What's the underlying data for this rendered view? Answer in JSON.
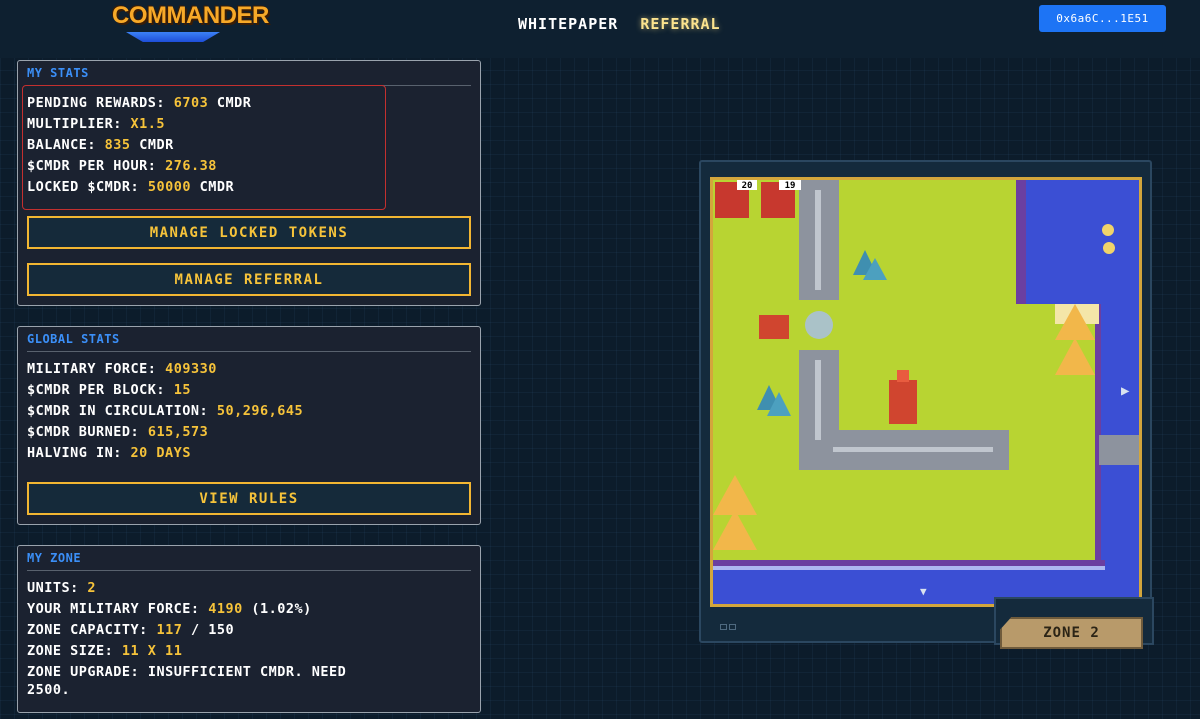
{
  "header": {
    "logo_text": "COMMANDER",
    "nav": [
      {
        "label": "WHITEPAPER",
        "active": false
      },
      {
        "label": "REFERRAL",
        "active": true
      }
    ],
    "wallet_label": "0x6a6C...1E51"
  },
  "my_stats": {
    "title": "MY STATS",
    "pending_rewards": {
      "label": "PENDING REWARDS:",
      "value": "6703",
      "unit": "CMDR"
    },
    "multiplier": {
      "label": "MULTIPLIER:",
      "value": "X1.5"
    },
    "balance": {
      "label": "BALANCE:",
      "value": "835",
      "unit": "CMDR"
    },
    "cmdr_per_hour": {
      "label": "$CMDR PER HOUR:",
      "value": "276.38"
    },
    "locked_cmdr": {
      "label": "LOCKED $CMDR:",
      "value": "50000",
      "unit": "CMDR"
    },
    "manage_locked_button": "MANAGE LOCKED TOKENS",
    "manage_referral_button": "MANAGE REFERRAL"
  },
  "global_stats": {
    "title": "GLOBAL STATS",
    "military_force": {
      "label": "MILITARY FORCE:",
      "value": "409330"
    },
    "cmdr_per_block": {
      "label": "$CMDR PER BLOCK:",
      "value": "15"
    },
    "cmdr_in_circulation": {
      "label": "$CMDR IN CIRCULATION:",
      "value": "50,296,645"
    },
    "cmdr_burned": {
      "label": "$CMDR BURNED:",
      "value": "615,573"
    },
    "halving_in": {
      "label": "HALVING IN:",
      "value": "20 DAYS"
    },
    "view_rules_button": "VIEW RULES"
  },
  "my_zone": {
    "title": "MY ZONE",
    "units": {
      "label": "UNITS:",
      "value": "2"
    },
    "your_military_force": {
      "label": "YOUR MILITARY FORCE:",
      "value": "4190",
      "extra": "(1.02%)"
    },
    "zone_capacity": {
      "label": "ZONE CAPACITY:",
      "value": "117",
      "sep": "/",
      "max": "150"
    },
    "zone_size": {
      "label": "ZONE SIZE:",
      "value": "11 X 11"
    },
    "zone_upgrade": {
      "label": "ZONE UPGRADE:",
      "value": "INSUFFICIENT CMDR. NEED",
      "value_line2": "2500."
    }
  },
  "map": {
    "zone_label": "ZONE 2",
    "unit_counts": [
      "20",
      "19"
    ],
    "arrow_right": "▶",
    "arrow_down": "▼"
  },
  "colors": {
    "accent_blue": "#1d74f5",
    "title_blue": "#3b8ff7",
    "value_yellow": "#f6c33a",
    "button_border": "#f2b632",
    "highlight_red": "#c3302f",
    "grass": "#b8d432",
    "water": "#3b4fd4"
  },
  "icons": [
    "soldier-unit-icon",
    "soldier-unit-icon",
    "tank-icon",
    "tower-icon",
    "tree-icon",
    "mountain-icon"
  ]
}
